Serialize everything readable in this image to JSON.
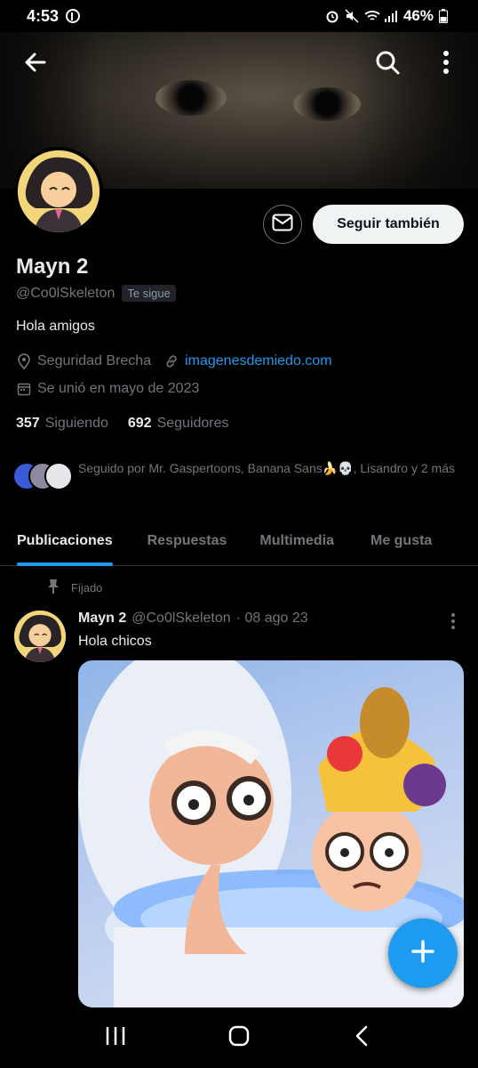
{
  "status_bar": {
    "time": "4:53",
    "battery": "46%"
  },
  "colors": {
    "accent": "#1d9bf0",
    "background": "#000000",
    "text_primary": "#e7e9ea",
    "text_secondary": "#71767b"
  },
  "header": {
    "back_icon": "arrow-left-icon",
    "search_icon": "search-icon",
    "more_icon": "more-vertical-icon"
  },
  "profile": {
    "name": "Mayn 2",
    "handle": "@Co0lSkeleton",
    "follows_you": "Te sigue",
    "bio": "Hola amigos",
    "location": "Seguridad Brecha",
    "website": "imagenesdemiedo.com",
    "joined": "Se unió en mayo de 2023",
    "following_count": "357",
    "following_label": "Siguiendo",
    "followers_count": "692",
    "followers_label": "Seguidores",
    "followed_by": "Seguido por Mr. Gaspertoons, Banana Sans🍌💀, Lisandro y 2 más"
  },
  "actions": {
    "message_icon": "envelope-icon",
    "follow_back_label": "Seguir también"
  },
  "tabs": [
    {
      "label": "Publicaciones",
      "active": true
    },
    {
      "label": "Respuestas",
      "active": false
    },
    {
      "label": "Multimedia",
      "active": false
    },
    {
      "label": "Me gusta",
      "active": false
    }
  ],
  "pinned_tweet": {
    "pinned_label": "Fijado",
    "author_name": "Mayn 2",
    "author_handle": "@Co0lSkeleton",
    "date": "· 08 ago 23",
    "text": "Hola chicos"
  },
  "fab": {
    "icon": "plus-icon"
  },
  "navigation": {
    "recent_icon": "recent-apps-icon",
    "home_icon": "home-circle-icon",
    "back_icon": "back-chevron-icon"
  }
}
